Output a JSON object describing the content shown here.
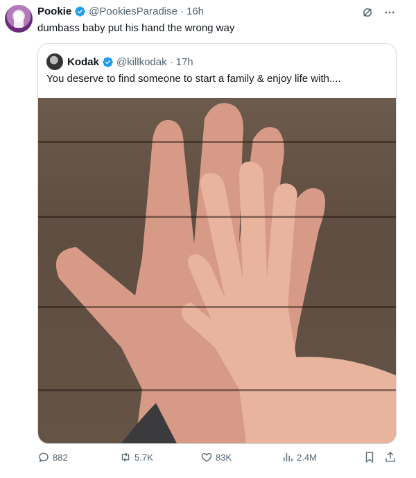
{
  "post": {
    "author_name": "Pookie",
    "author_handle": "@PookiesParadise",
    "time": "16h",
    "text": "dumbass baby put his hand the wrong way"
  },
  "quoted": {
    "author_name": "Kodak",
    "author_handle": "@killkodak",
    "time": "17h",
    "text": "You deserve to find someone to start a family & enjoy life with...."
  },
  "separator": "·",
  "actions": {
    "replies": "882",
    "reposts": "5.7K",
    "likes": "83K",
    "views": "2.4M"
  },
  "icons": {
    "verified": "verified-badge-icon",
    "grok": "grok-icon",
    "more": "more-icon",
    "reply": "reply-icon",
    "repost": "repost-icon",
    "like": "like-icon",
    "views": "views-icon",
    "bookmark": "bookmark-icon",
    "share": "share-icon"
  },
  "colors": {
    "verified": "#1d9bf0",
    "secondary_text": "#536471",
    "border": "#cfd9de"
  }
}
